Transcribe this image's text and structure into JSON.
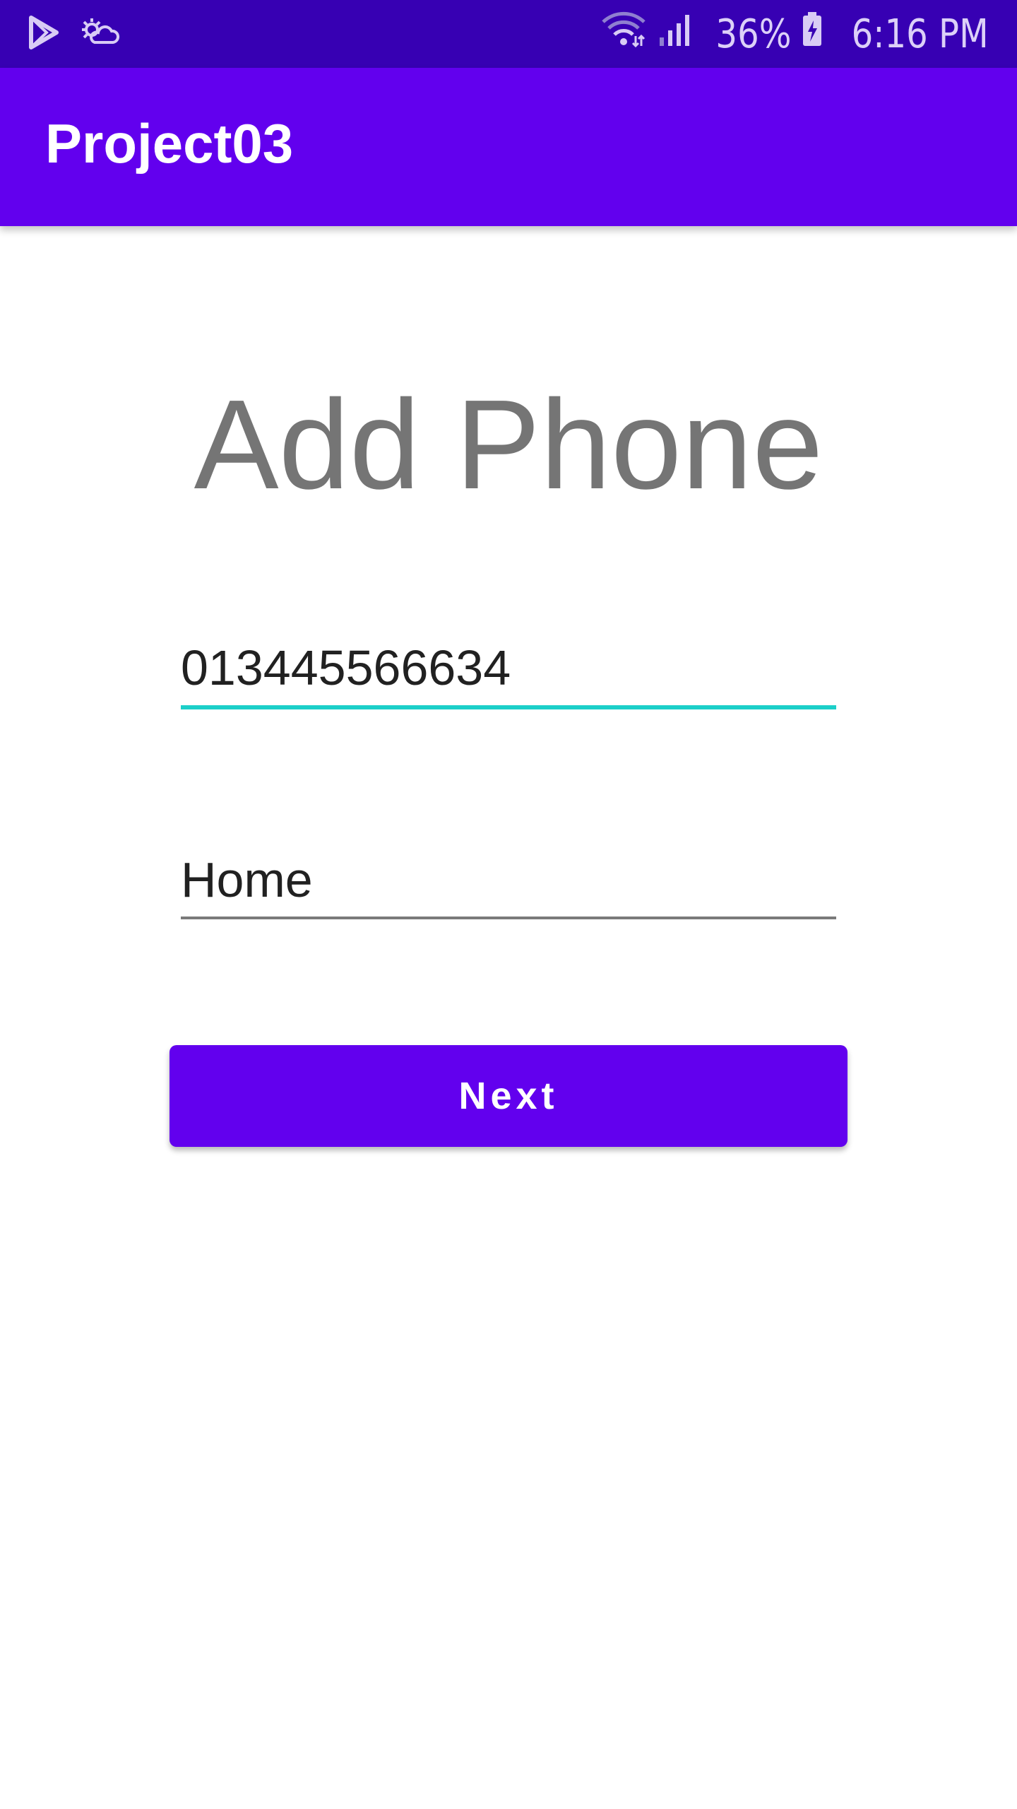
{
  "status_bar": {
    "battery_percent": "36%",
    "time": "6:16 PM",
    "icons": [
      "play-store-icon",
      "weather-icon",
      "wifi-icon",
      "signal-icon",
      "battery-charging-icon"
    ]
  },
  "app_bar": {
    "title": "Project03"
  },
  "screen": {
    "heading": "Add Phone",
    "phone_field": {
      "value": "013445566634",
      "focused": true
    },
    "label_field": {
      "value": "Home"
    },
    "next_button": {
      "label": "Next"
    }
  },
  "colors": {
    "status_bar": "#3700b3",
    "primary": "#6200ee",
    "accent_underline": "#1ccfc9",
    "heading_text": "#757575"
  }
}
